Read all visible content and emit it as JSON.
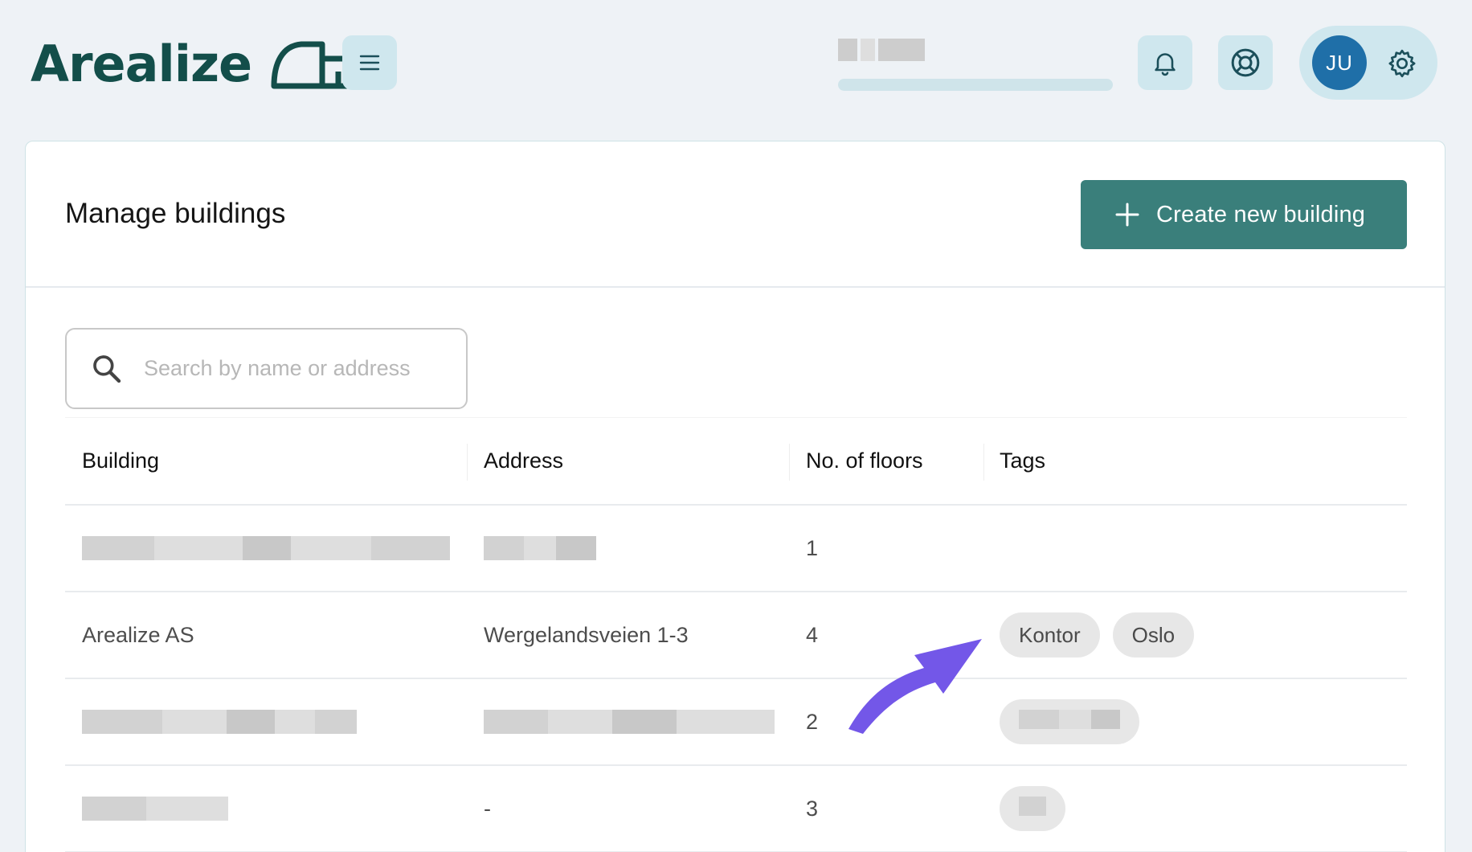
{
  "app": {
    "name": "Arealize"
  },
  "header": {
    "avatar_initials": "JU",
    "icons": [
      "menu-icon",
      "bell-icon",
      "help-lifebuoy-icon",
      "gear-icon"
    ]
  },
  "page": {
    "title": "Manage buildings",
    "create_button": "Create new building"
  },
  "search": {
    "placeholder": "Search by name or address",
    "value": ""
  },
  "table": {
    "columns": [
      "Building",
      "Address",
      "No. of floors",
      "Tags"
    ],
    "rows": [
      {
        "building": "",
        "address": "",
        "floors": "1",
        "tags": []
      },
      {
        "building": "Arealize AS",
        "address": "Wergelandsveien 1-3",
        "floors": "4",
        "tags": [
          "Kontor",
          "Oslo"
        ]
      },
      {
        "building": "",
        "address": "",
        "floors": "2",
        "tags": [
          ""
        ]
      },
      {
        "building": "",
        "address": "-",
        "floors": "3",
        "tags": [
          ""
        ]
      }
    ]
  },
  "colors": {
    "brand": "#134e4a",
    "primary_button": "#3a7f7b",
    "avatar": "#1f6fa8",
    "icon_button_bg": "#cfe7ee",
    "annotation_arrow": "#7357e8"
  }
}
